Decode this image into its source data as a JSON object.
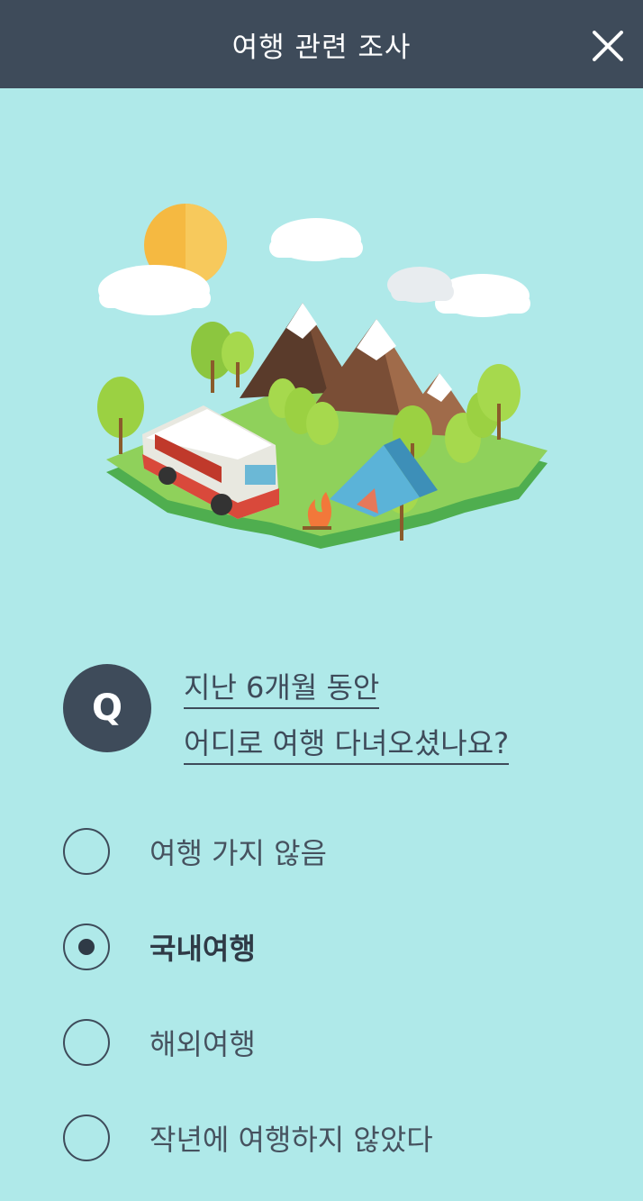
{
  "header": {
    "title": "여행 관련 조사",
    "close_icon": "close-icon"
  },
  "question": {
    "badge": "Q",
    "line1": "지난 6개월 동안",
    "line2": "어디로 여행 다녀오셨나요?"
  },
  "options": [
    {
      "label": "여행 가지 않음",
      "selected": false
    },
    {
      "label": "국내여행",
      "selected": true
    },
    {
      "label": "해외여행",
      "selected": false
    },
    {
      "label": "작년에 여행하지 않았다",
      "selected": false
    }
  ],
  "colors": {
    "background": "#afe9e9",
    "header": "#3e4b5a",
    "text": "#3e4b5a"
  }
}
